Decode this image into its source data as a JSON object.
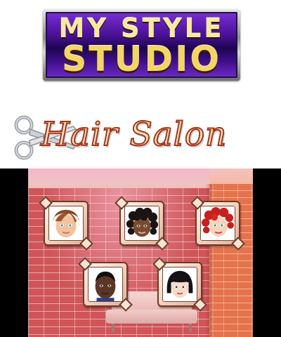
{
  "logo": {
    "line1": "MY STYLE",
    "line2": "STUDIO"
  },
  "title": {
    "text": "Hair Salon",
    "icon": "scissors-icon"
  },
  "scene": {
    "characters": [
      {
        "id": "brunette-woman",
        "icon": "face-brown-hair-icon"
      },
      {
        "id": "curly-dark-woman",
        "icon": "face-black-curly-hair-icon"
      },
      {
        "id": "redhead-woman",
        "icon": "face-red-curly-hair-icon"
      },
      {
        "id": "dark-man",
        "icon": "face-short-black-hair-man-icon"
      },
      {
        "id": "bob-woman",
        "icon": "face-black-bob-hair-icon"
      }
    ]
  }
}
